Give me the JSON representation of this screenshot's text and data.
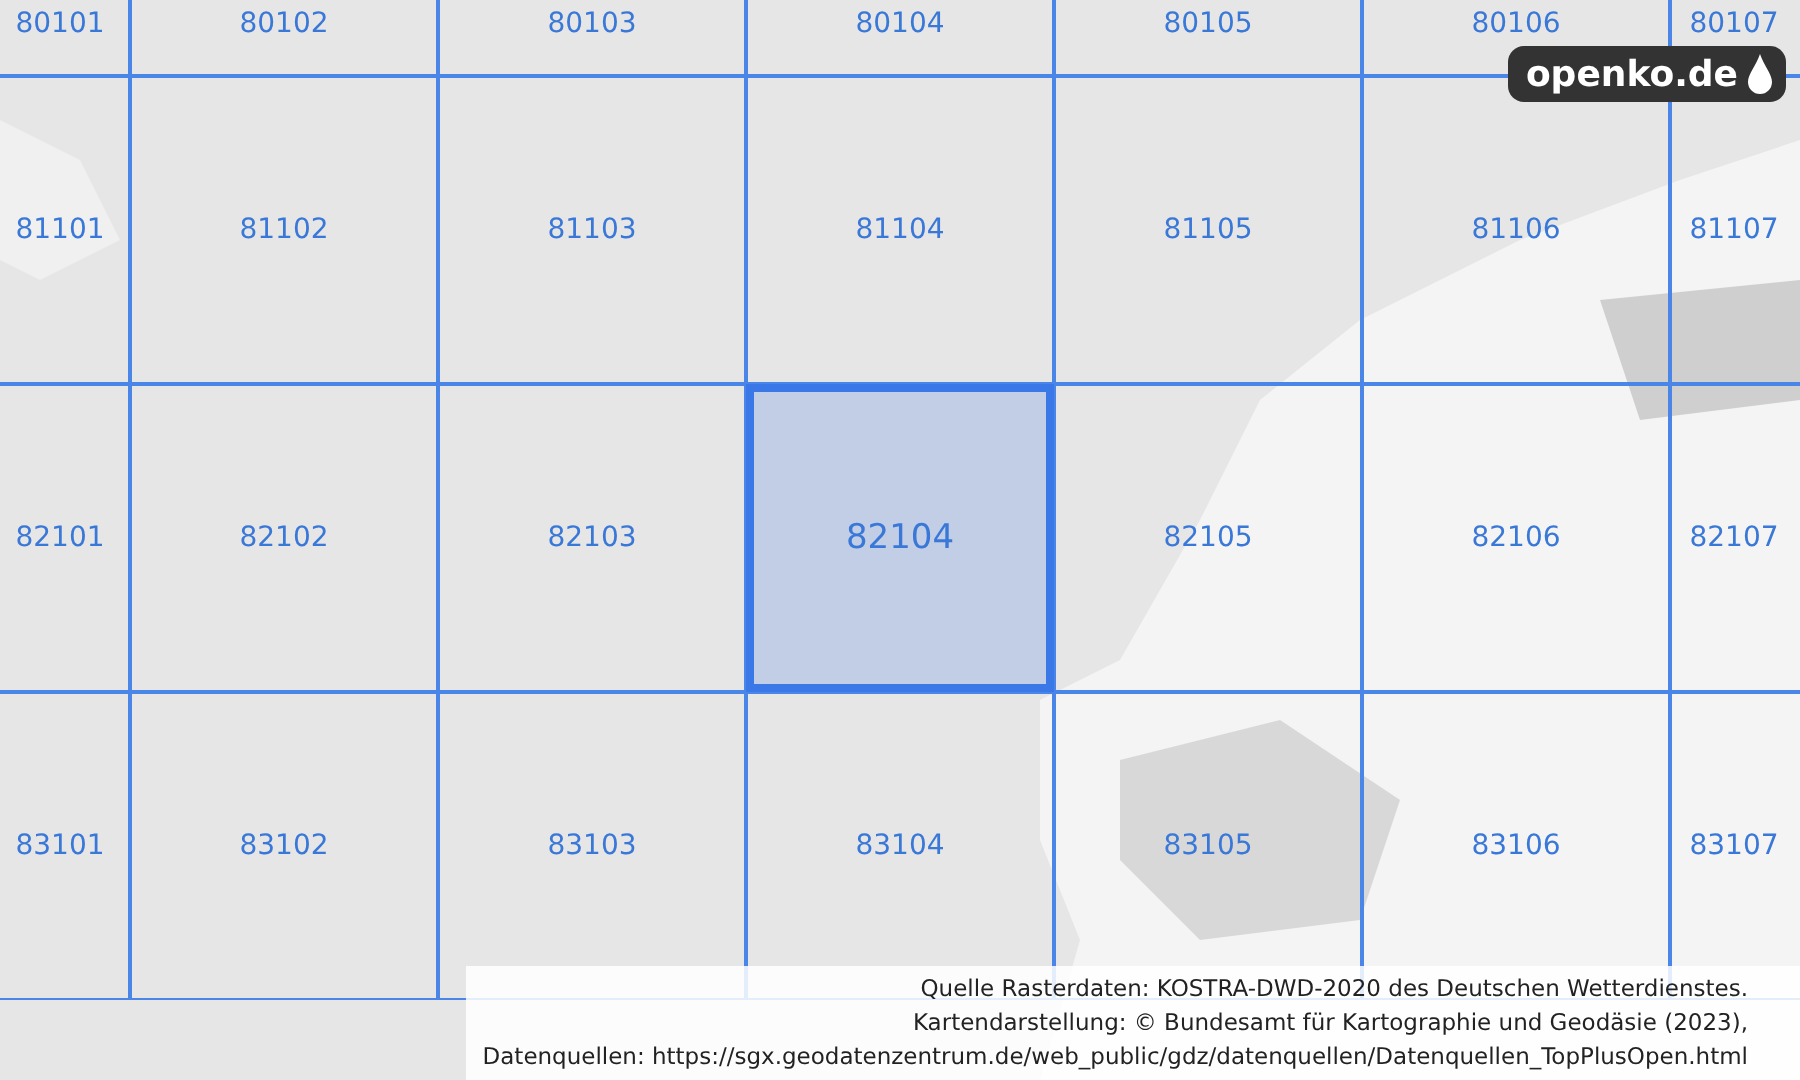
{
  "grid": {
    "rows": [
      {
        "cells": [
          {
            "label": "80101",
            "selected": false
          },
          {
            "label": "80102",
            "selected": false
          },
          {
            "label": "80103",
            "selected": false
          },
          {
            "label": "80104",
            "selected": false
          },
          {
            "label": "80105",
            "selected": false
          },
          {
            "label": "80106",
            "selected": false
          },
          {
            "label": "80107",
            "selected": false
          }
        ]
      },
      {
        "cells": [
          {
            "label": "81101",
            "selected": false
          },
          {
            "label": "81102",
            "selected": false
          },
          {
            "label": "81103",
            "selected": false
          },
          {
            "label": "81104",
            "selected": false
          },
          {
            "label": "81105",
            "selected": false
          },
          {
            "label": "81106",
            "selected": false
          },
          {
            "label": "81107",
            "selected": false
          }
        ]
      },
      {
        "cells": [
          {
            "label": "82101",
            "selected": false
          },
          {
            "label": "82102",
            "selected": false
          },
          {
            "label": "82103",
            "selected": false
          },
          {
            "label": "82104",
            "selected": true
          },
          {
            "label": "82105",
            "selected": false
          },
          {
            "label": "82106",
            "selected": false
          },
          {
            "label": "82107",
            "selected": false
          }
        ]
      },
      {
        "cells": [
          {
            "label": "83101",
            "selected": false
          },
          {
            "label": "83102",
            "selected": false
          },
          {
            "label": "83103",
            "selected": false
          },
          {
            "label": "83104",
            "selected": false
          },
          {
            "label": "83105",
            "selected": false
          },
          {
            "label": "83106",
            "selected": false
          },
          {
            "label": "83107",
            "selected": false
          }
        ]
      }
    ]
  },
  "logo": {
    "text": "openko.de"
  },
  "attribution": [
    "Quelle Rasterdaten: KOSTRA-DWD-2020 des Deutschen Wetterdienstes.",
    "Kartendarstellung: © Bundesamt für Kartographie und Geodäsie (2023),",
    "Datenquellen: https://sgx.geodatenzentrum.de/web_public/gdz/datenquellen/Datenquellen_TopPlusOpen.html"
  ]
}
